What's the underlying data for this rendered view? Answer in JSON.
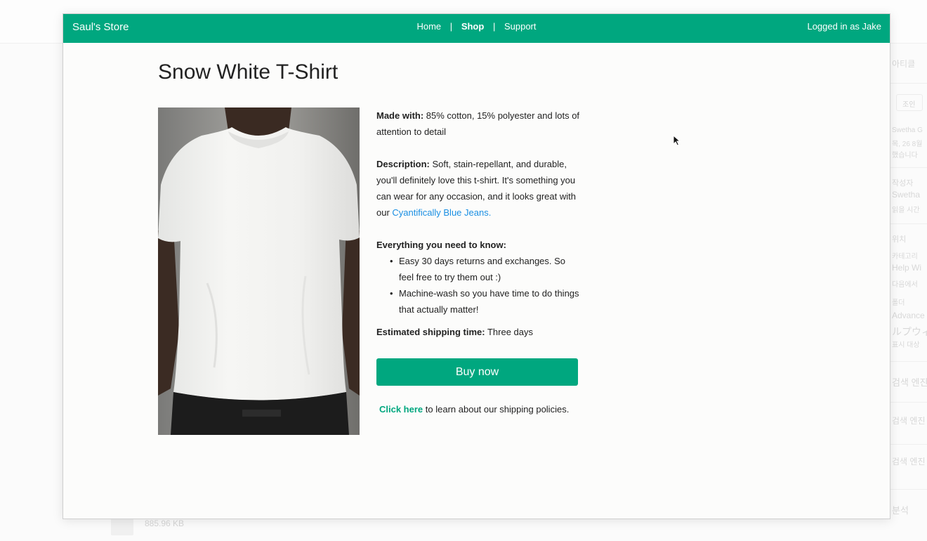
{
  "background": {
    "side_items": [
      "아티클",
      "조인",
      "Swetha G",
      "목, 26 8월",
      "했습니다",
      "작성자",
      "Swetha",
      "읽을 시간",
      "위치",
      "카테고리",
      "Help Wi",
      "다음에서",
      "폴더",
      "Advance",
      "ルプウィ",
      "표시 대상",
      "검색 엔진",
      "검색 엔진",
      "검색 엔진",
      "분석"
    ],
    "file_size": "885.96 KB"
  },
  "navbar": {
    "brand": "Saul's Store",
    "links": [
      "Home",
      "Shop",
      "Support"
    ],
    "separator": "|",
    "user": "Logged in as Jake",
    "color": "#00a77f"
  },
  "product": {
    "title": "Snow White T-Shirt",
    "made_with_label": "Made with:",
    "made_with_value": "85% cotton, 15% polyester and lots of attention to detail",
    "description_label": "Description:",
    "description_value": "Soft, stain-repellant, and durable, you'll definitely love this t-shirt. It's something you can wear for any occasion, and it looks great with our",
    "description_link": "Cyantifically Blue Jeans.",
    "know_heading": "Everything you need to know:",
    "bullets": [
      "Easy 30 days returns and exchanges. So feel free to try them out :)",
      "Machine-wash so you have time to do things that actually matter!"
    ],
    "shipping_label": "Estimated shipping time:",
    "shipping_value": "Three days",
    "buy_label": "Buy now",
    "policy_link": "Click here",
    "policy_text": "to learn about our shipping policies."
  },
  "icons": {
    "image": "t-shirt-model-photo",
    "cursor": "mouse-pointer-icon"
  },
  "colors": {
    "accent": "#00a77f",
    "link": "#1a8fe3"
  }
}
